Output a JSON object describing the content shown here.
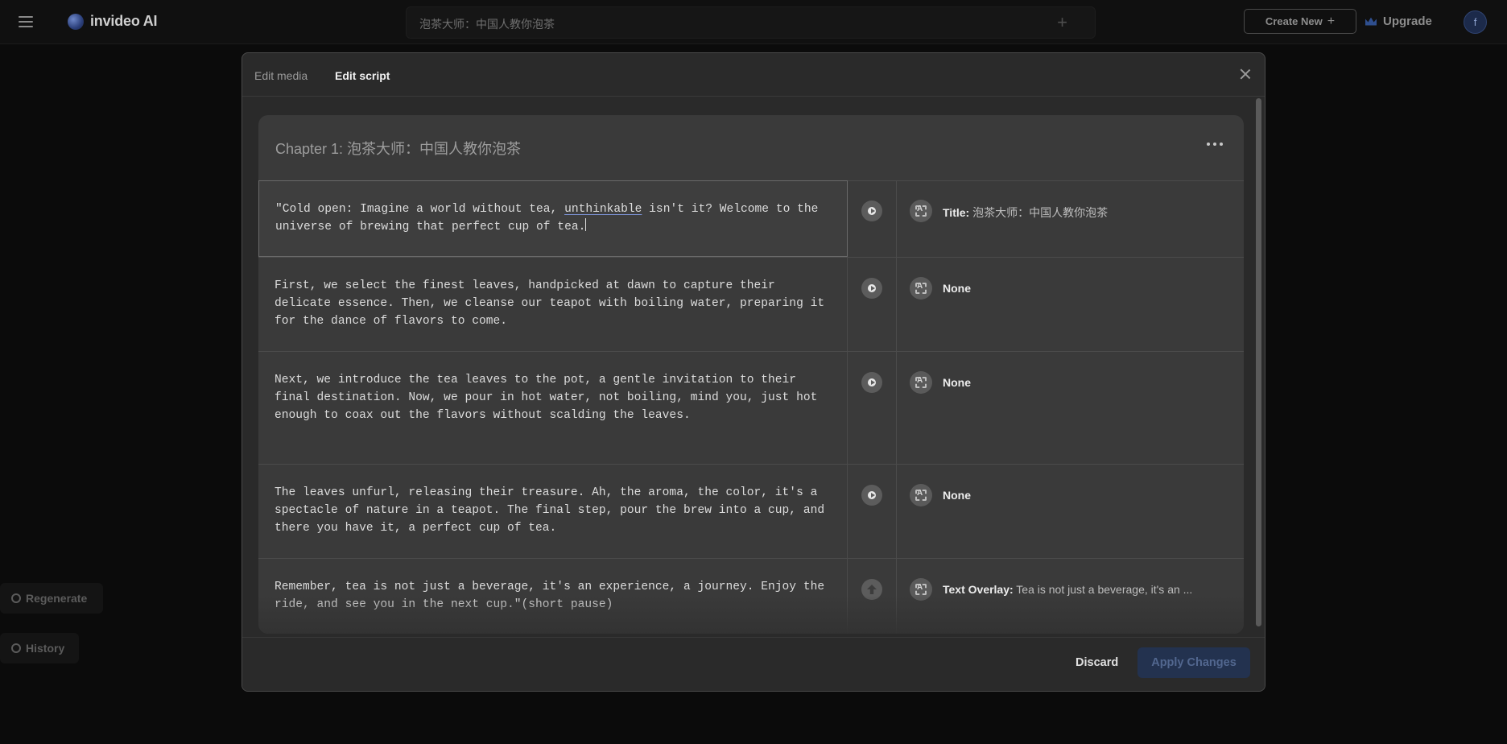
{
  "app": {
    "name": "invideo AI"
  },
  "header": {
    "search_value": "泡茶大师：中国人教你泡茶",
    "plus_glyph": "+",
    "create_new_label": "Create New",
    "upgrade_label": "Upgrade",
    "avatar_initial": "f"
  },
  "sidebar": {
    "regenerate_label": "Regenerate",
    "history_label": "History"
  },
  "modal": {
    "tabs": [
      {
        "label": "Edit media",
        "active": false
      },
      {
        "label": "Edit script",
        "active": true
      }
    ],
    "chapter_title": "Chapter 1: 泡茶大师：中国人教你泡茶",
    "rows": [
      {
        "text_parts": [
          "\"Cold open: Imagine a world without tea, ",
          "unthinkable",
          " isn't it? Welcome to the universe of brewing that perfect cup of tea."
        ],
        "media_type": "Title:",
        "media_value": " 泡茶大师：中国人教你泡茶",
        "action": "play"
      },
      {
        "text": "First, we select the finest leaves, handpicked at dawn to capture their delicate essence. Then, we cleanse our teapot with boiling water, preparing it for the dance of flavors to come.",
        "media_type": "None",
        "media_value": "",
        "action": "play"
      },
      {
        "text": "Next, we introduce the tea leaves to the pot, a gentle invitation to their final destination. Now, we pour in hot water, not boiling, mind you, just hot enough to coax out the flavors without scalding the leaves.",
        "media_type": "None",
        "media_value": "",
        "action": "play"
      },
      {
        "text": "The leaves unfurl, releasing their treasure. Ah, the aroma, the color, it's a spectacle of nature in a teapot. The final step, pour the brew into a cup, and there you have it, a perfect cup of tea.",
        "media_type": "None",
        "media_value": "",
        "action": "play"
      },
      {
        "text": "Remember, tea is not just a beverage, it's an experience, a journey. Enjoy the ride, and see you in the next cup.\"(short pause)",
        "media_type": "Text Overlay:",
        "media_value": " Tea is not just a beverage, it's an ...",
        "action": "upload"
      }
    ],
    "discard_label": "Discard",
    "apply_label": "Apply Changes"
  },
  "colors": {
    "background": "#0b0b0b",
    "modal": "#2a2a2a",
    "card": "#3a3a3a",
    "apply_button": "#23324f"
  }
}
